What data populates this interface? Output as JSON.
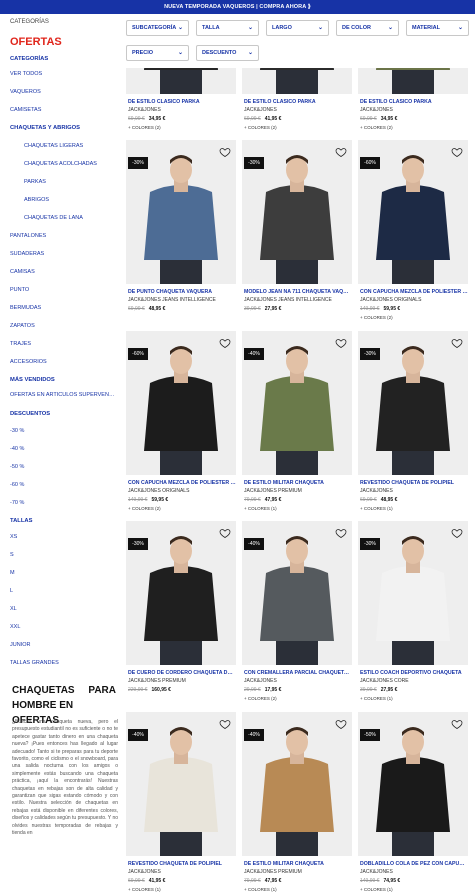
{
  "promo_bar": "NUEVA TEMPORADA VAQUEROS | COMPRA AHORA  ⟫",
  "sidebar": {
    "breadcrumb": "CATEGORÍAS",
    "title": "OFERTAS",
    "categories_heading": "CATEGORÍAS",
    "categories": [
      "VER TODOS",
      "VAQUEROS",
      "CAMISETAS"
    ],
    "coats_heading": "CHAQUETAS Y ABRIGOS",
    "coats_sub": [
      "CHAQUETAS LIGERAS",
      "CHAQUETAS ACOLCHADAS",
      "PARKAS",
      "ABRIGOS",
      "CHAQUETAS DE LANA"
    ],
    "more_categories": [
      "PANTALONES",
      "SUDADERAS",
      "CAMISAS",
      "PUNTO",
      "BERMUDAS",
      "ZAPATOS",
      "TRAJES",
      "ACCESORIOS"
    ],
    "bestsellers_heading": "MÁS VENDIDOS",
    "bestsellers": [
      "OFERTAS EN ARTÍCULOS SUPERVENTAS"
    ],
    "discounts_heading": "DESCUENTOS",
    "discounts": [
      "-30 %",
      "-40 %",
      "-50 %",
      "-60 %",
      "-70 %"
    ],
    "sizes_heading": "TALLAS",
    "sizes": [
      "XS",
      "S",
      "M",
      "L",
      "XL",
      "XXL",
      "JUNIOR",
      "TALLAS GRANDES"
    ]
  },
  "seo": {
    "title_line1_a": "CHAQUETAS",
    "title_line1_b": "PARA",
    "title_line2": "HOMBRE EN OFERTAS",
    "text": "¿Buscas una chaqueta nueva, pero el presupuesto estudiantil no es suficiente o no te apetece gastar tanto dinero en una chaqueta nueva? ¡Pues entonces has llegado al lugar adecuado! Tanto si te preparas para tu deporte favorito, como el ciclismo o el snowboard, para una salida nocturna con los amigos o simplemente estás buscando una chaqueta práctica, ¡aquí la encontrarás! Nuestras chaquetas en rebajas son de alta calidad y garantizan que sigas estando cómodo y con estilo. Nuestra selección de chaquetas en rebajas está disponible en diferentes colores, diseños y calidades según tu presupuesto. Y no olvides nuestras temporadas de rebajas y tienda en"
  },
  "filters": [
    "SUBCATEGORÍA",
    "TALLA",
    "LARGO",
    "DE COLOR",
    "MATERIAL",
    "PRECIO",
    "DESCUENTO"
  ],
  "products": [
    {
      "name": "DE ESTILO CLÁSICO PARKA",
      "brand": "JACK&JONES",
      "old_price": "69,99 €",
      "price": "34,95 €",
      "colors": "COLORES (2)",
      "badge": "",
      "color": "#262626"
    },
    {
      "name": "DE ESTILO CLÁSICO PARKA",
      "brand": "JACK&JONES",
      "old_price": "69,99 €",
      "price": "41,95 €",
      "colors": "COLORES (2)",
      "badge": "",
      "color": "#2b2b2b"
    },
    {
      "name": "DE ESTILO CLÁSICO PARKA",
      "brand": "JACK&JONES",
      "old_price": "69,99 €",
      "price": "34,95 €",
      "colors": "COLORES (2)",
      "badge": "",
      "color": "#6b7448"
    },
    {
      "name": "DE PUNTO CHAQUETA VAQUERA",
      "brand": "JACK&JONES JEANS INTELLIGENCE",
      "old_price": "69,99 €",
      "price": "48,95 €",
      "colors": "",
      "badge": "-30%",
      "color": "#4d6c95"
    },
    {
      "name": "MODELO JEAN NA 711 CHAQUETA VAQUERA",
      "brand": "JACK&JONES JEANS INTELLIGENCE",
      "old_price": "39,99 €",
      "price": "27,95 €",
      "colors": "",
      "badge": "-30%",
      "color": "#3d3d3d"
    },
    {
      "name": "CON CAPUCHA MEZCLA DE POLIÉSTER RECICLADO",
      "brand": "JACK&JONES ORIGINALS",
      "old_price": "149,99 €",
      "price": "59,95 €",
      "colors": "COLORES (2)",
      "badge": "-60%",
      "color": "#1d2a45"
    },
    {
      "name": "CON CAPUCHA MEZCLA DE POLIÉSTER RECICLADO",
      "brand": "JACK&JONES ORIGINALS",
      "old_price": "149,99 €",
      "price": "59,95 €",
      "colors": "COLORES (2)",
      "badge": "-60%",
      "color": "#1c1c1c"
    },
    {
      "name": "DE ESTILO MILITAR CHAQUETA",
      "brand": "JACK&JONES PREMIUM",
      "old_price": "79,99 €",
      "price": "47,95 €",
      "colors": "COLORES (1)",
      "badge": "-40%",
      "color": "#6a7a4a"
    },
    {
      "name": "REVESTIDO CHAQUETA DE POLIPIEL",
      "brand": "JACK&JONES",
      "old_price": "69,99 €",
      "price": "48,95 €",
      "colors": "COLORES (1)",
      "badge": "-30%",
      "color": "#222222"
    },
    {
      "name": "DE CUERO DE CORDERO CHAQUETA DE CUERO",
      "brand": "JACK&JONES PREMIUM",
      "old_price": "229,99 €",
      "price": "160,95 €",
      "colors": "",
      "badge": "-30%",
      "color": "#1f1f1f"
    },
    {
      "name": "CON CREMALLERA PARCIAL CHAQUETA ACOLCHADA",
      "brand": "JACK&JONES",
      "old_price": "29,99 €",
      "price": "17,95 €",
      "colors": "COLORES (2)",
      "badge": "-40%",
      "color": "#555a5e"
    },
    {
      "name": "ESTILO COACH DEPORTIVO CHAQUETA",
      "brand": "JACK&JONES CORE",
      "old_price": "39,99 €",
      "price": "27,95 €",
      "colors": "COLORES (1)",
      "badge": "-30%",
      "color": "#f2f2f2"
    },
    {
      "name": "REVESTIDO CHAQUETA DE POLIPIEL",
      "brand": "JACK&JONES",
      "old_price": "69,99 €",
      "price": "41,95 €",
      "colors": "COLORES (1)",
      "badge": "-40%",
      "color": "#e8e4da"
    },
    {
      "name": "DE ESTILO MILITAR CHAQUETA",
      "brand": "JACK&JONES PREMIUM",
      "old_price": "79,99 €",
      "price": "47,95 €",
      "colors": "COLORES (1)",
      "badge": "-40%",
      "color": "#b88a55"
    },
    {
      "name": "DOBLADILLO COLA DE PEZ CON CAPUCHA PARKA",
      "brand": "JACK&JONES",
      "old_price": "149,99 €",
      "price": "74,95 €",
      "colors": "COLORES (1)",
      "badge": "-50%",
      "color": "#1a1a1a"
    }
  ]
}
